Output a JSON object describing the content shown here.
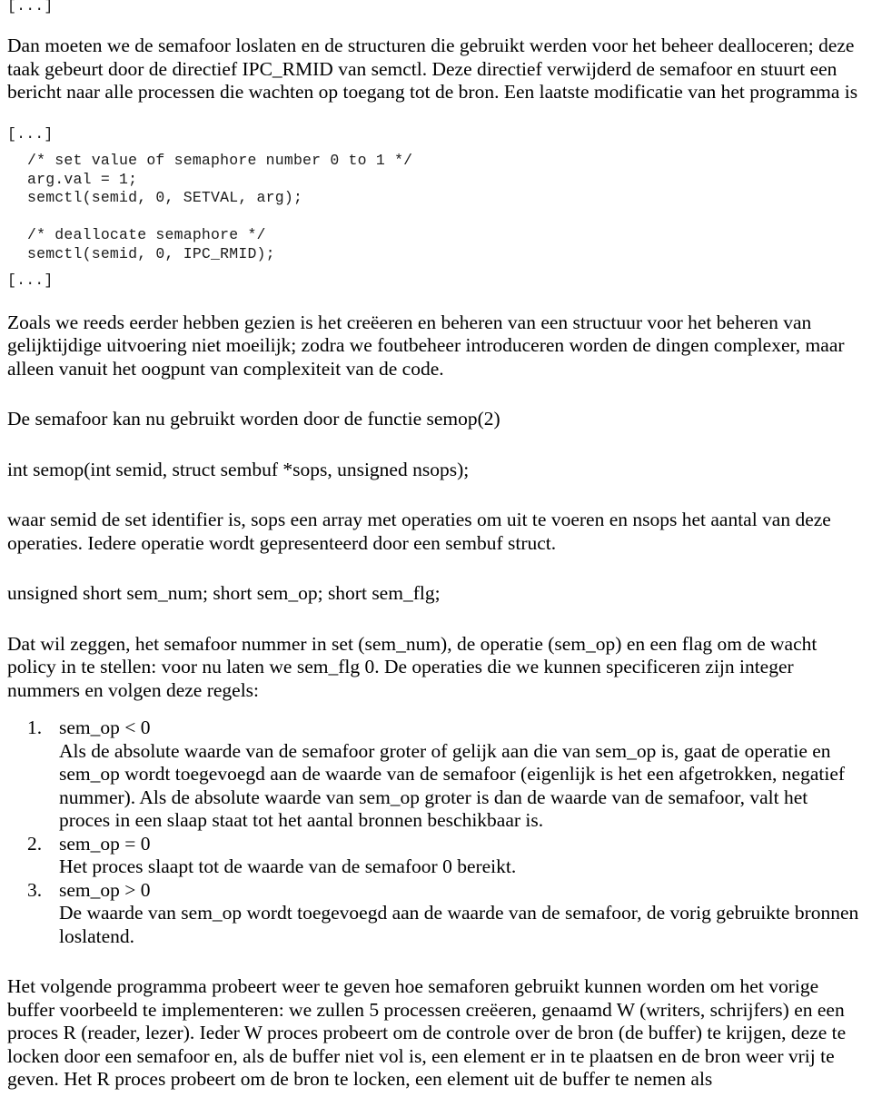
{
  "document": {
    "language": "nl",
    "top_ellipsis": "[...]",
    "intro_paragraph": "Dan moeten we de semafoor loslaten en de structuren die gebruikt werden voor het beheer dealloceren; deze taak gebeurt door de directief IPC_RMID van semctl. Deze directief verwijderd de semafoor en stuurt een bericht naar alle processen die wachten op toegang tot de bron. Een laatste modificatie van het programma is",
    "code_ellipsis_before": "[...]",
    "code_block": "/* set value of semaphore number 0 to 1 */\narg.val = 1;\nsemctl(semid, 0, SETVAL, arg);\n\n/* deallocate semaphore */\nsemctl(semid, 0, IPC_RMID);",
    "code_ellipsis_after": "[...]",
    "paragraph_complexity": "Zoals we reeds eerder hebben gezien is het creëeren en beheren van een structuur voor het beheren van gelijktijdige uitvoering niet moeilijk; zodra we foutbeheer introduceren worden de dingen complexer, maar alleen vanuit het oogpunt van complexiteit van de code.",
    "paragraph_semop_intro": "De semafoor kan nu gebruikt worden door de functie semop(2)",
    "signature_semop": "int semop(int semid, struct sembuf *sops, unsigned nsops);",
    "paragraph_semop_explain": "waar semid de set identifier is, sops een array met operaties om uit te voeren en nsops het aantal van deze operaties. Iedere operatie wordt gepresenteerd door een sembuf struct.",
    "struct_sembuf_fields": "unsigned short sem_num; short sem_op; short sem_flg;",
    "paragraph_sembuf_explain": "Dat wil zeggen, het semafoor nummer in set (sem_num), de operatie (sem_op) en een flag om de wacht policy in te stellen: voor nu laten we sem_flg 0. De operaties die we kunnen specificeren zijn integer nummers en volgen deze regels:",
    "rules": [
      {
        "marker": "1.",
        "head": "sem_op < 0",
        "body": "Als de absolute waarde van de semafoor groter of gelijk aan die van sem_op is, gaat de operatie en sem_op wordt toegevoegd aan de waarde van de semafoor (eigenlijk is het een afgetrokken, negatief nummer). Als de absolute waarde van sem_op groter is dan de waarde van de semafoor, valt het proces in een slaap staat tot het aantal bronnen beschikbaar is."
      },
      {
        "marker": "2.",
        "head": "sem_op = 0",
        "body": "Het proces slaapt tot de waarde van de semafoor 0 bereikt."
      },
      {
        "marker": "3.",
        "head": "sem_op > 0",
        "body": "De waarde van sem_op wordt toegevoegd aan de waarde van de semafoor, de vorig gebruikte bronnen loslatend."
      }
    ],
    "paragraph_next_program": "Het volgende programma probeert weer te geven hoe semaforen gebruikt kunnen worden om het vorige buffer voorbeeld te implementeren: we zullen 5 processen creëeren, genaamd W (writers, schrijfers) en een proces R (reader, lezer). Ieder W proces probeert om de controle over de bron (de buffer) te krijgen, deze te locken door een semafoor en, als de buffer niet vol is, een element er in te plaatsen en de bron weer vrij te geven. Het R proces probeert om de bron te locken, een element uit de buffer te nemen als"
  }
}
